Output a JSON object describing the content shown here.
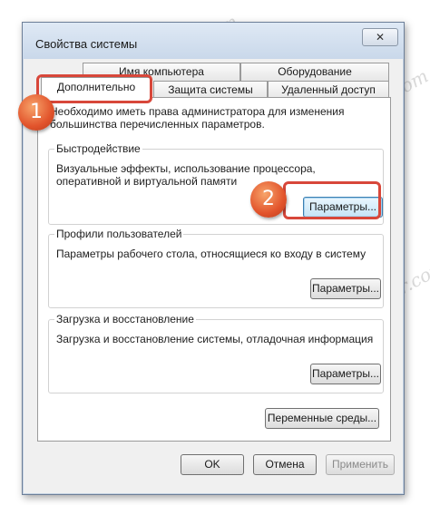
{
  "window": {
    "title": "Свойства системы",
    "close_glyph": "✕"
  },
  "tabs_back": [
    {
      "label": "Имя компьютера"
    },
    {
      "label": "Оборудование"
    }
  ],
  "tabs_front": [
    {
      "label": "Дополнительно",
      "active": true
    },
    {
      "label": "Защита системы"
    },
    {
      "label": "Удаленный доступ"
    }
  ],
  "notice": "Необходимо иметь права администратора для изменения большинства перечисленных параметров.",
  "performance": {
    "title": "Быстродействие",
    "description": "Визуальные эффекты, использование процессора, оперативной и виртуальной памяти",
    "button": "Параметры..."
  },
  "profiles": {
    "title": "Профили пользователей",
    "description": "Параметры рабочего стола, относящиеся ко входу в систему",
    "button": "Параметры..."
  },
  "startup": {
    "title": "Загрузка и восстановление",
    "description": "Загрузка и восстановление системы, отладочная информация",
    "button": "Параметры..."
  },
  "env_button": "Переменные среды...",
  "footer": {
    "ok": "OK",
    "cancel": "Отмена",
    "apply": "Применить"
  },
  "annotations": {
    "step1": "1",
    "step2": "2",
    "highlight_color": "#d8473a"
  },
  "watermark": "Sovingcomputer.com"
}
